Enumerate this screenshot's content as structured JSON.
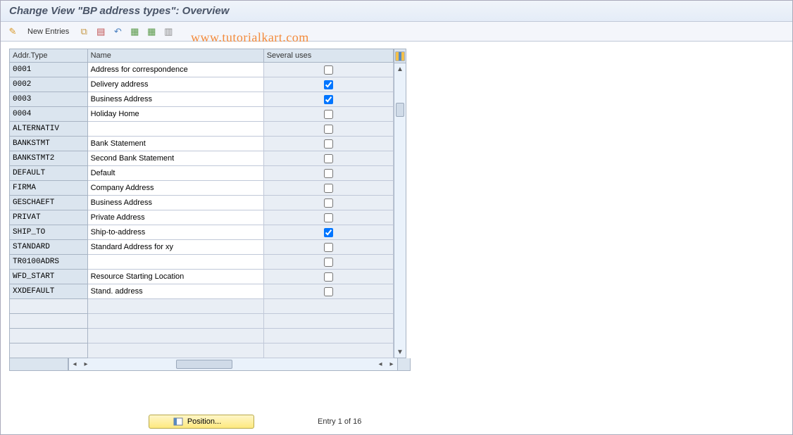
{
  "title": "Change View \"BP address types\": Overview",
  "toolbar": {
    "new_entries_label": "New Entries"
  },
  "watermark": "www.tutorialkart.com",
  "columns": {
    "addr_type": "Addr.Type",
    "name": "Name",
    "several_uses": "Several uses"
  },
  "rows": [
    {
      "type": "0001",
      "name": "Address for correspondence",
      "several": false
    },
    {
      "type": "0002",
      "name": "Delivery address",
      "several": true
    },
    {
      "type": "0003",
      "name": "Business Address",
      "several": true
    },
    {
      "type": "0004",
      "name": "Holiday Home",
      "several": false
    },
    {
      "type": "ALTERNATIV",
      "name": "",
      "several": false
    },
    {
      "type": "BANKSTMT",
      "name": "Bank Statement",
      "several": false
    },
    {
      "type": "BANKSTMT2",
      "name": "Second Bank Statement",
      "several": false
    },
    {
      "type": "DEFAULT",
      "name": "Default",
      "several": false
    },
    {
      "type": "FIRMA",
      "name": "Company Address",
      "several": false
    },
    {
      "type": "GESCHAEFT",
      "name": "Business Address",
      "several": false
    },
    {
      "type": "PRIVAT",
      "name": "Private Address",
      "several": false
    },
    {
      "type": "SHIP_TO",
      "name": "Ship-to-address",
      "several": true
    },
    {
      "type": "STANDARD",
      "name": "Standard Address for xy",
      "several": false
    },
    {
      "type": "TR0100ADRS",
      "name": "",
      "several": false
    },
    {
      "type": "WFD_START",
      "name": "Resource Starting Location",
      "several": false
    },
    {
      "type": "XXDEFAULT",
      "name": "Stand. address",
      "several": false
    }
  ],
  "empty_rows": 4,
  "footer": {
    "position_label": "Position...",
    "entry_text": "Entry 1 of 16"
  }
}
